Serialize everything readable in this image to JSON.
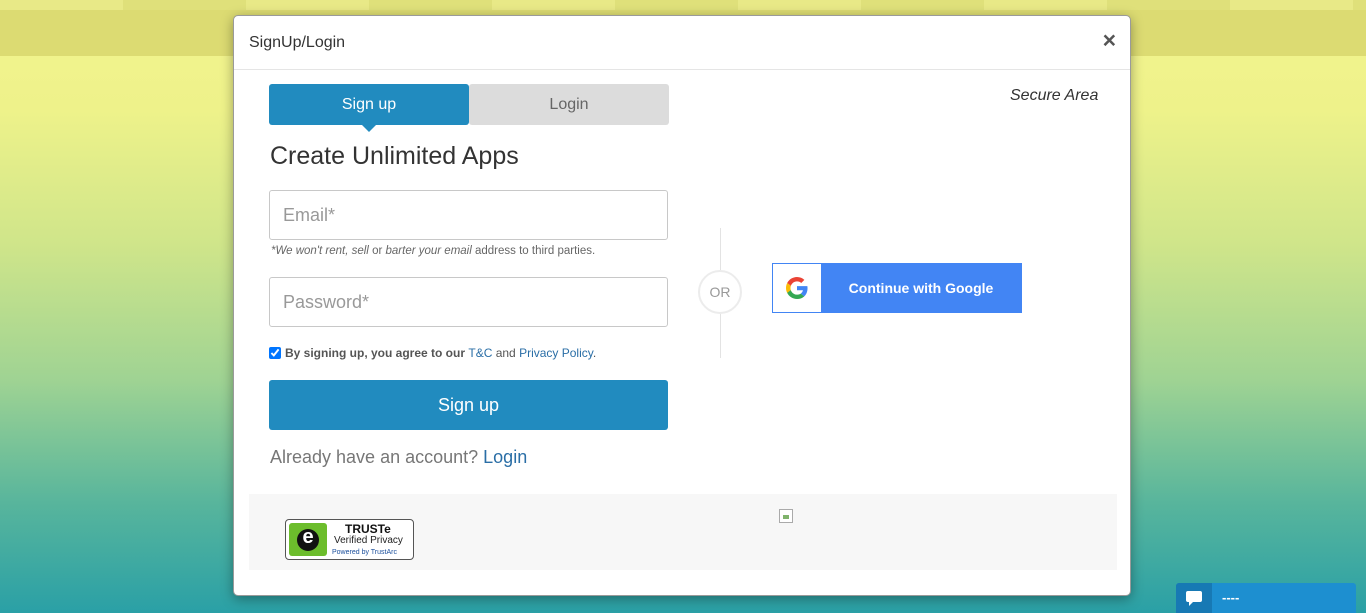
{
  "modal": {
    "title": "SignUp/Login",
    "close": "×",
    "secure_label": "Secure Area"
  },
  "tabs": [
    {
      "label": "Sign up",
      "active": true
    },
    {
      "label": "Login",
      "active": false
    }
  ],
  "form": {
    "heading": "Create Unlimited Apps",
    "email_placeholder": "Email*",
    "email_note": {
      "prefix": "*We won't rent, ",
      "sell": "sell",
      "or": " or ",
      "barter": "barter your email",
      "suffix": " address to third parties."
    },
    "password_placeholder": "Password*",
    "agree": {
      "checked": true,
      "text": "By signing up, you agree to our ",
      "tc": "T&C",
      "and": " and ",
      "privacy": "Privacy Policy",
      "end": "."
    },
    "submit_label": "Sign up",
    "already_text": "Already have an account? ",
    "already_link": "Login"
  },
  "divider": {
    "or_label": "OR"
  },
  "google": {
    "label": "Continue with Google"
  },
  "footer": {
    "truste": {
      "title": "TRUSTe",
      "subtitle": "Verified Privacy",
      "powered": "Powered by TrustArc"
    }
  },
  "chat": {
    "label": "----"
  },
  "colors": {
    "primary": "#218bbf",
    "google": "#4285f4",
    "link": "#2a6ea6"
  }
}
